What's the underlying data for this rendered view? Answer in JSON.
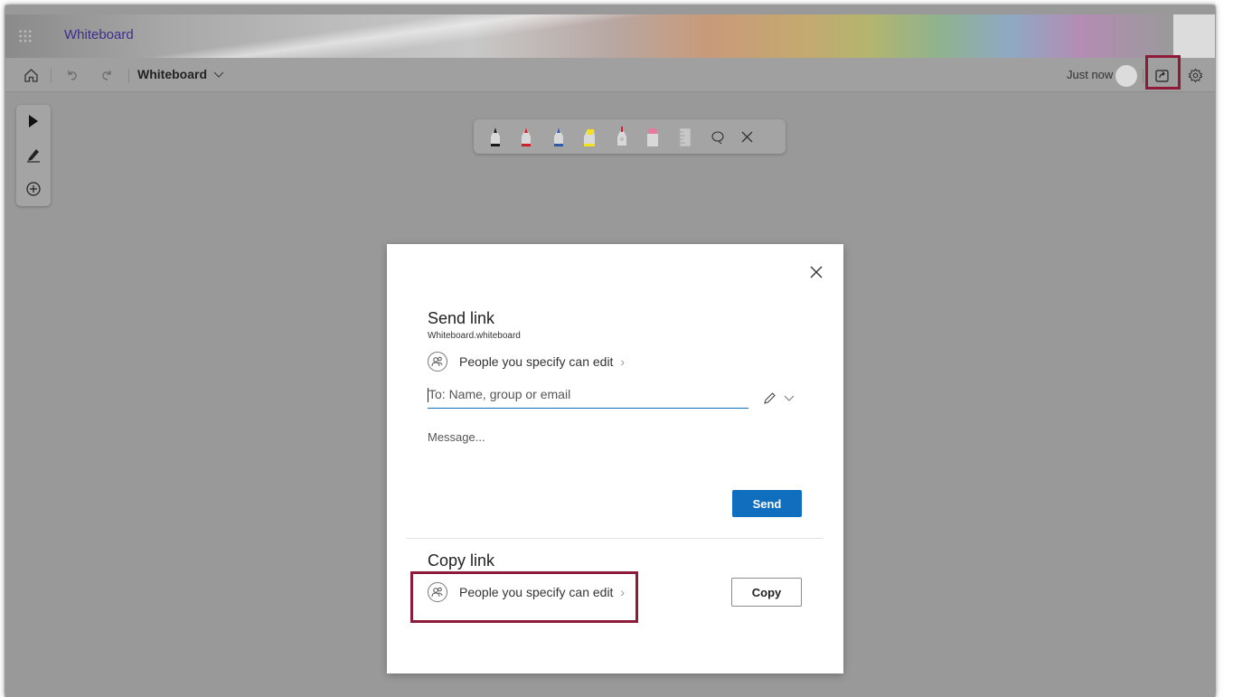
{
  "app": {
    "title": "Whiteboard"
  },
  "toolbar": {
    "board_name": "Whiteboard",
    "status": "Just now"
  },
  "pens": {
    "colors": [
      "#1a1a1a",
      "#d11f2b",
      "#2f5aa8",
      "#f2e21a",
      "#d11f2b",
      "#e57a9a"
    ],
    "items": [
      "black-pen",
      "red-pen",
      "blue-pen",
      "yellow-highlighter",
      "red-pen-2",
      "eraser",
      "ruler",
      "lasso-select",
      "close"
    ]
  },
  "dialog": {
    "send_title": "Send link",
    "file_name": "Whiteboard.whiteboard",
    "send_permission": "People you specify can edit",
    "to_placeholder": "To: Name, group or email",
    "message_placeholder": "Message...",
    "send_label": "Send",
    "copy_title": "Copy link",
    "copy_permission": "People you specify can edit",
    "copy_label": "Copy"
  },
  "colors": {
    "accent": "#106ebe",
    "highlight": "#8e1a3a",
    "brand": "#3c2f88"
  }
}
